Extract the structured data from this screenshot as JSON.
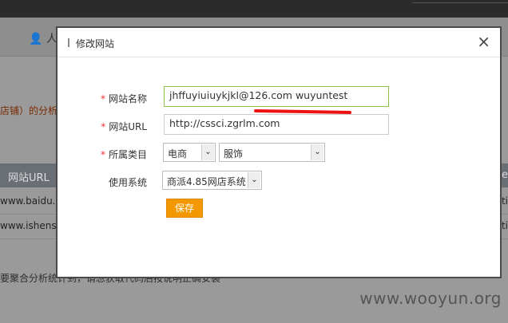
{
  "background": {
    "user_label": "人",
    "analysis_text": "店铺）的分析，",
    "table_header": "网站URL",
    "rows": [
      "www.baidu.c",
      "www.ishensh"
    ],
    "row_right_chars": [
      "ti",
      "ti"
    ],
    "header_right_char": "te",
    "bottom_text": "要聚合分析统计到，请忽获取代码后按说明正确安装"
  },
  "modal": {
    "title": "修改网站",
    "close_label": "×",
    "fields": {
      "site_name_label": "网站名称",
      "site_name_value": "jhffuyiuiuykjkl@126.com wuyuntest",
      "site_url_label": "网站URL",
      "site_url_value": "http://cssci.zgrlm.com",
      "category_label": "所属类目",
      "category_primary": "电商",
      "category_secondary": "服饰",
      "system_label": "使用系统",
      "system_value": "商派4.85网店系统"
    },
    "required_marker": "*",
    "save_label": "保存"
  },
  "watermark": "www.wooyun.org",
  "colors": {
    "accent": "#f39800",
    "required": "#e33333",
    "active_border": "#8dc24c",
    "annotation": "#e11111"
  }
}
